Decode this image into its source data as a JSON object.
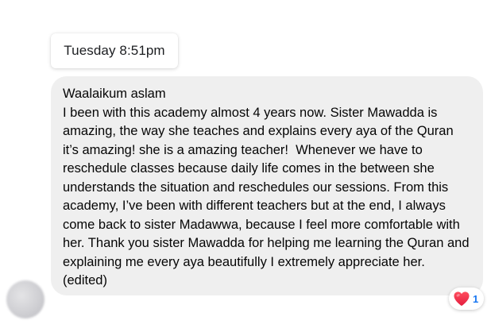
{
  "timestamp": {
    "label": "Tuesday 8:51pm"
  },
  "message": {
    "greeting": "Waalaikum aslam",
    "body": "I been with this academy almost 4 years now. Sister Mawadda is amazing, the way she teaches and explains every aya of the Quran it’s amazing! she is a amazing teacher!  Whenever we have to reschedule classes because daily life comes in the between she understands the situation and reschedules our sessions. From this academy, I’ve been with different teachers but at the end, I always come back to sister Madawwa, because I feel more comfortable with her. Thank you sister Mawadda for helping me learning the Quran and explaining me every aya beautifully I extremely appreciate her. (edited)"
  },
  "reaction": {
    "icon": "heart-icon",
    "color": "#e41e3f",
    "count": "1",
    "count_color": "#1877f2"
  },
  "avatar": {
    "icon": "avatar-blurred"
  }
}
